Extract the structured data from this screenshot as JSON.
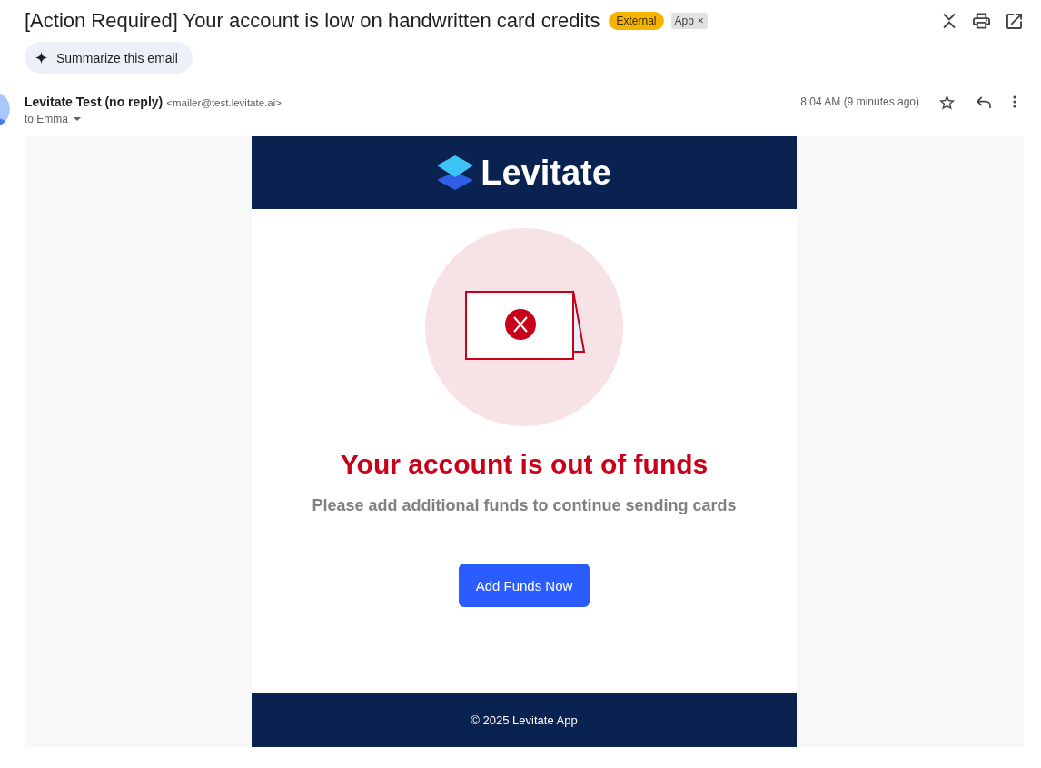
{
  "subject": {
    "title": "[Action Required] Your account is low on handwritten card credits",
    "labels": [
      {
        "text": "External",
        "color": "#f6b400"
      },
      {
        "text": "App",
        "color": "#e1e1e1",
        "remove": "×"
      }
    ]
  },
  "summarize": {
    "label": "Summarize this email"
  },
  "sender": {
    "name": "Levitate Test (no reply)",
    "address": "<mailer@test.levitate.ai>",
    "recipient": "to Emma",
    "time": "8:04 AM (9 minutes ago)",
    "starred": false
  },
  "message": {
    "brand": "Levitate",
    "headline": "Your account is out of funds",
    "text": "Please add additional funds to continue sending cards",
    "button": "Add Funds Now",
    "footer": "© 2025 Levitate App"
  }
}
